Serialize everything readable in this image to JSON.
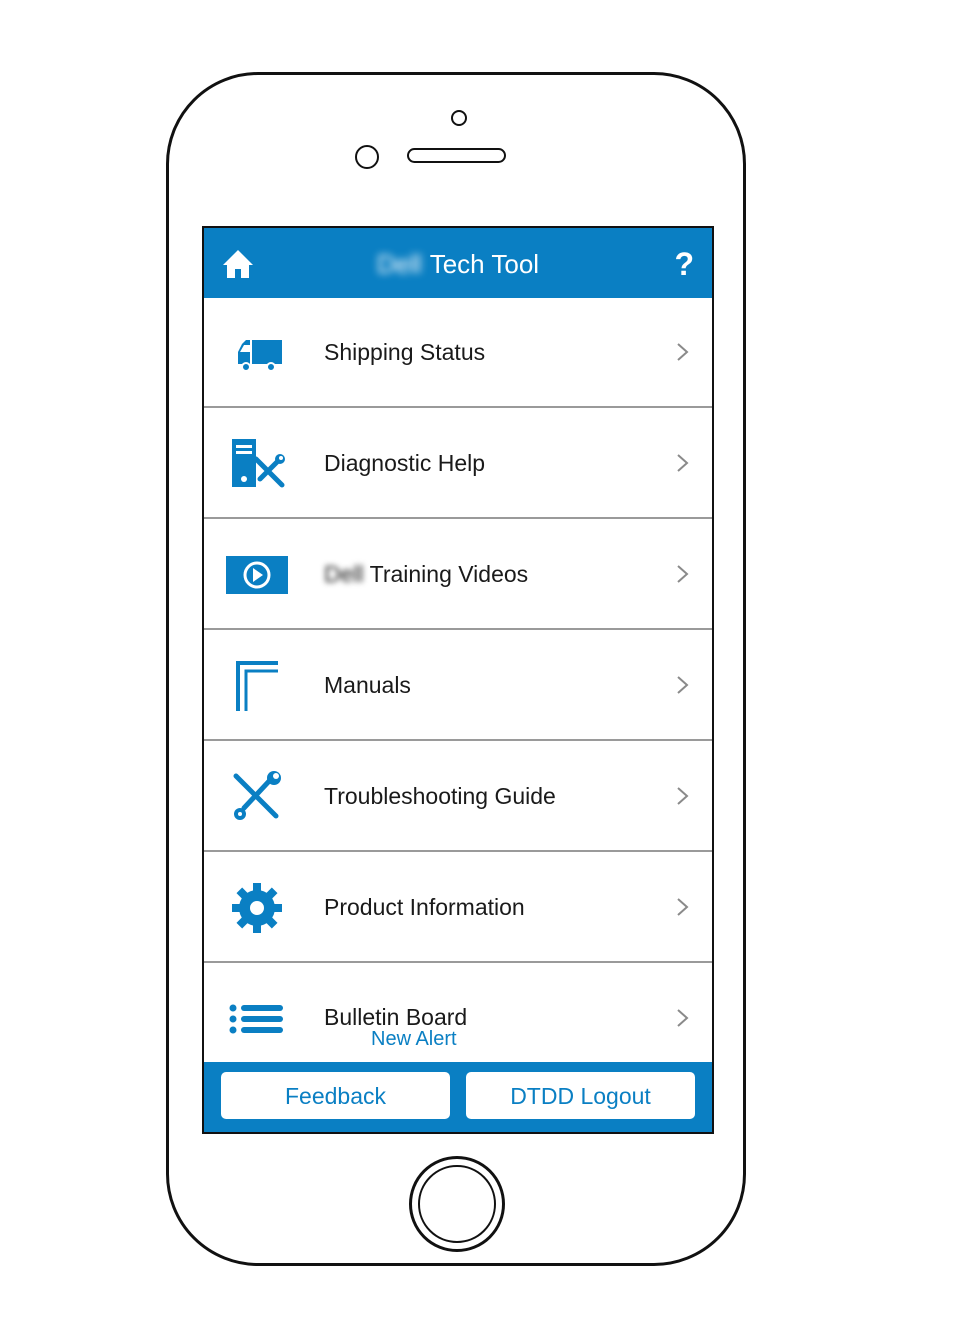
{
  "header": {
    "brand": "Dell",
    "title": "Tech Tool",
    "help": "?"
  },
  "menu": [
    {
      "label": "Shipping Status",
      "icon": "truck-icon"
    },
    {
      "label": "Diagnostic Help",
      "icon": "computer-tools-icon"
    },
    {
      "brand": "Dell",
      "label": "Training Videos",
      "icon": "video-play-icon"
    },
    {
      "label": "Manuals",
      "icon": "manuals-icon"
    },
    {
      "label": "Troubleshooting Guide",
      "icon": "tools-icon"
    },
    {
      "label": "Product Information",
      "icon": "gear-icon"
    },
    {
      "label": "Bulletin Board",
      "sub": "New Alert",
      "icon": "list-icon"
    }
  ],
  "footer": {
    "feedback": "Feedback",
    "logout": "DTDD Logout"
  },
  "colors": {
    "accent": "#0a7fc3",
    "text": "#1a1a1a",
    "divider": "#9a9a9a"
  }
}
